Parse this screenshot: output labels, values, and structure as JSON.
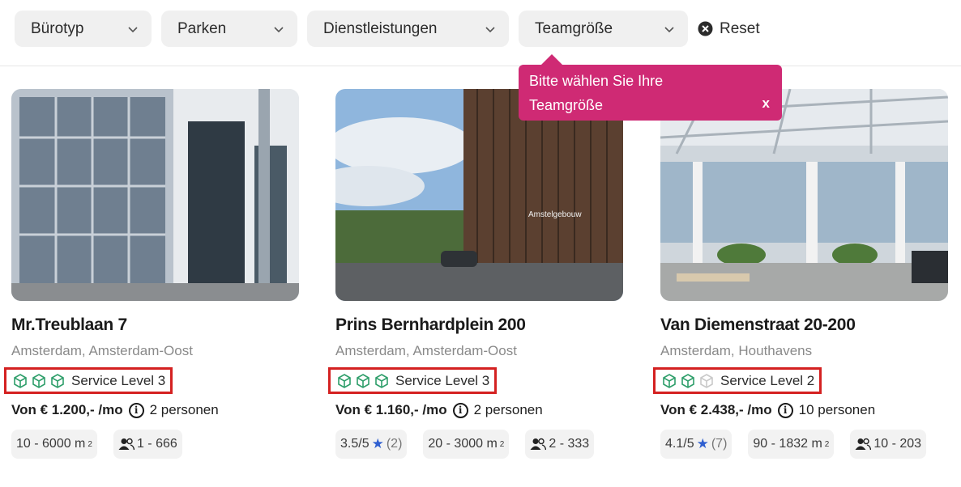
{
  "filters": [
    {
      "label": "Bürotyp"
    },
    {
      "label": "Parken"
    },
    {
      "label": "Dienstleistungen"
    },
    {
      "label": "Teamgröße"
    }
  ],
  "reset_label": "Reset",
  "tooltip": {
    "line1": "Bitte wählen Sie Ihre",
    "line2": "Teamgröße",
    "close": "x"
  },
  "cards": [
    {
      "title": "Mr.Treublaan 7",
      "city": "Amsterdam",
      "district": "Amsterdam-Oost",
      "service_level": "Service Level 3",
      "price": "Von € 1.200,- /mo",
      "persons": "2 personen",
      "area": "10 - 6000 m",
      "team": "1 - 666"
    },
    {
      "title": "Prins Bernhardplein 200",
      "city": "Amsterdam",
      "district": "Amsterdam-Oost",
      "service_level": "Service Level 3",
      "price": "Von € 1.160,- /mo",
      "persons": "2 personen",
      "rating": "3.5/5",
      "reviews": "(2)",
      "area": "20 - 3000 m",
      "team": "2 - 333",
      "sign_text": "Amstelgebouw"
    },
    {
      "title": "Van Diemenstraat 20-200",
      "city": "Amsterdam",
      "district": "Houthavens",
      "service_level": "Service Level 2",
      "price": "Von € 2.438,- /mo",
      "persons": "10 personen",
      "rating": "4.1/5",
      "reviews": "(7)",
      "area": "90 - 1832 m",
      "team": "10 - 203"
    }
  ],
  "unit_sup": "2",
  "separator": ",",
  "colors": {
    "tooltip": "#cf2a74",
    "highlight_border": "#d42121",
    "cube_active": "#2e9e6a",
    "cube_inactive": "#c9c9c9",
    "star": "#2f5fd0"
  },
  "icons": {
    "filter_chevron": "chevron-down-icon",
    "reset": "close-circle-icon",
    "service_cube": "cube-icon",
    "info": "info-icon",
    "team": "people-icon",
    "rating": "star-icon"
  }
}
